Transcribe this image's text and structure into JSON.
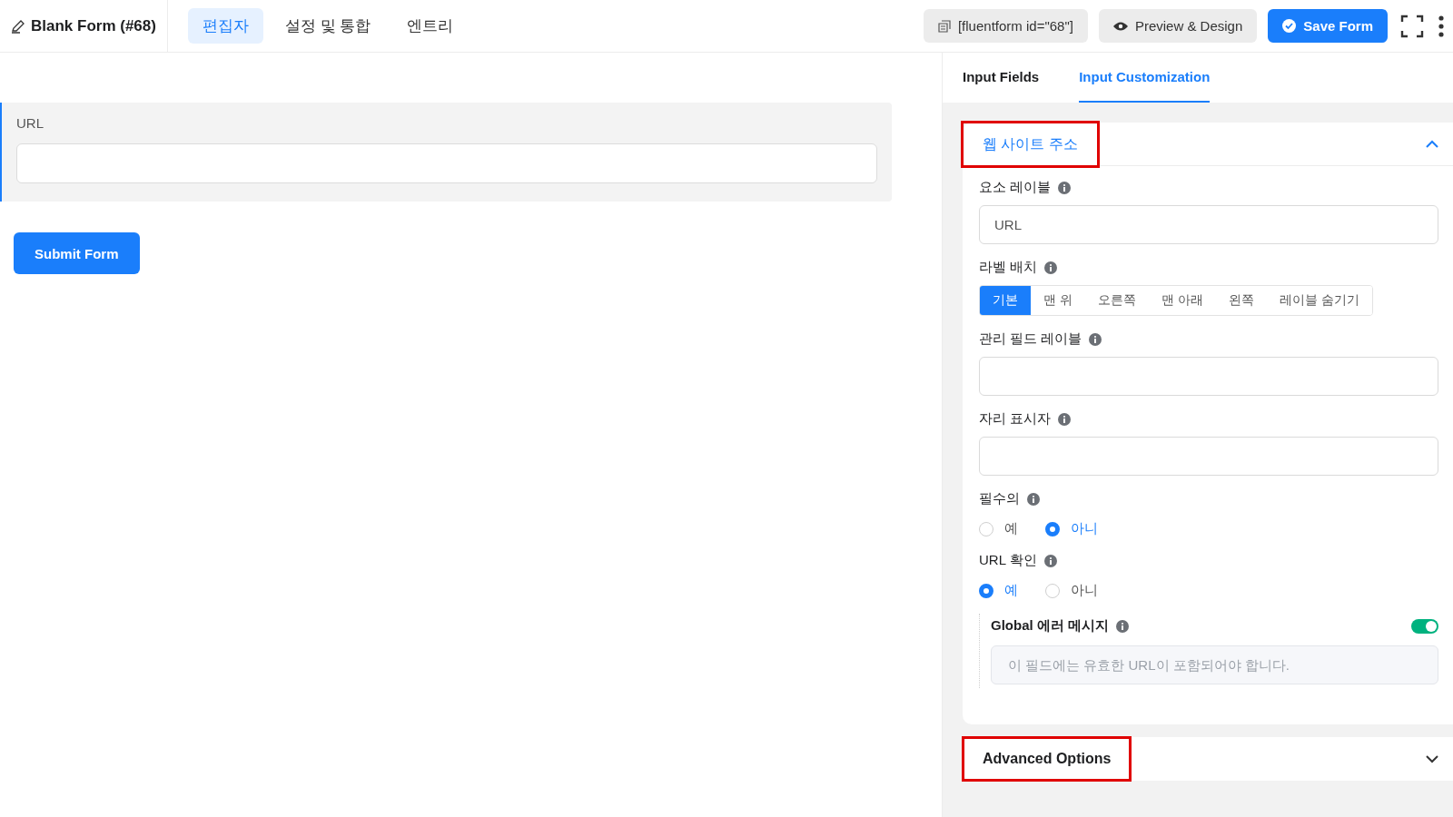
{
  "header": {
    "title": "Blank Form (#68)",
    "nav": [
      {
        "label": "편집자",
        "selected": true
      },
      {
        "label": "설정 및 통합",
        "selected": false
      },
      {
        "label": "엔트리",
        "selected": false
      }
    ],
    "shortcode": "[fluentform id=\"68\"]",
    "preview_button": "Preview & Design",
    "save_button": "Save Form"
  },
  "form": {
    "fields": [
      {
        "label": "URL"
      }
    ],
    "submit": "Submit Form"
  },
  "sidebar": {
    "tabs": [
      {
        "label": "Input Fields",
        "selected": false
      },
      {
        "label": "Input Customization",
        "selected": true
      }
    ],
    "section": {
      "title": "웹 사이트 주소",
      "expanded": true,
      "highlighted": true,
      "settings": [
        {
          "kind": "text",
          "label": "요소 레이블",
          "value": "URL"
        },
        {
          "kind": "segmented",
          "label": "라벨 배치",
          "options": [
            {
              "label": "기본",
              "selected": true
            },
            {
              "label": "맨 위",
              "selected": false
            },
            {
              "label": "오른쪽",
              "selected": false
            },
            {
              "label": "맨 아래",
              "selected": false
            },
            {
              "label": "왼쪽",
              "selected": false
            },
            {
              "label": "레이블 숨기기",
              "selected": false
            }
          ]
        },
        {
          "kind": "text",
          "label": "관리 필드 레이블"
        },
        {
          "kind": "text",
          "label": "자리 표시자"
        },
        {
          "kind": "radio",
          "label": "필수의",
          "options": [
            {
              "label": "예",
              "selected": false
            },
            {
              "label": "아니",
              "selected": true
            }
          ]
        },
        {
          "kind": "radio",
          "label": "URL 확인",
          "options": [
            {
              "label": "예",
              "selected": true
            },
            {
              "label": "아니",
              "selected": false
            }
          ]
        },
        {
          "kind": "toggle",
          "label": "Global 에러 메시지",
          "on": true,
          "placeholder": "이 필드에는 유효한 URL이 포함되어야 합니다."
        }
      ]
    },
    "advanced": {
      "title": "Advanced Options",
      "expanded": false,
      "highlighted": true
    }
  }
}
